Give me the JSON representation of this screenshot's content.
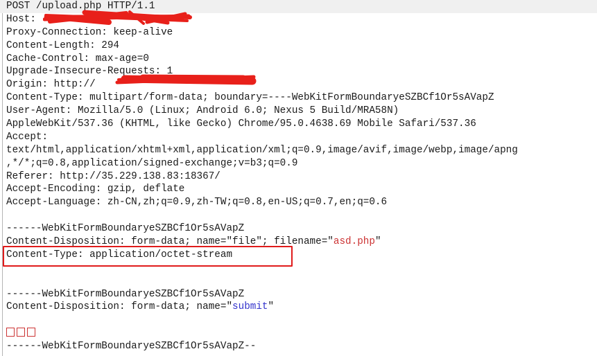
{
  "viewer": {
    "name": "http-request-raw-view",
    "boundary": "----WebKitFormBoundaryeSZBCf1Or5sAVapZ",
    "highlight_color": "#f0f0f0",
    "redaction_color": "#e8201a",
    "annotation_box_color": "#e01b1b",
    "string_red_color": "#cc3333",
    "string_blue_color": "#3333cc",
    "gutter_marker_color": "#e8a33d"
  },
  "lines": [
    {
      "id": "request-line",
      "text": "POST /upload.php HTTP/1.1",
      "highlight": true
    },
    {
      "id": "header-host",
      "text": "Host: "
    },
    {
      "id": "header-proxy-connection",
      "text": "Proxy-Connection: keep-alive"
    },
    {
      "id": "header-content-length",
      "text": "Content-Length: 294"
    },
    {
      "id": "header-cache-control",
      "text": "Cache-Control: max-age=0"
    },
    {
      "id": "header-upgrade-insecure",
      "text": "Upgrade-Insecure-Requests: 1"
    },
    {
      "id": "header-origin",
      "text": "Origin: http://"
    },
    {
      "id": "header-content-type",
      "text": "Content-Type: multipart/form-data; boundary=----WebKitFormBoundaryeSZBCf1Or5sAVapZ"
    },
    {
      "id": "header-user-agent",
      "text": "User-Agent: Mozilla/5.0 (Linux; Android 6.0; Nexus 5 Build/MRA58N)"
    },
    {
      "id": "header-user-agent-cont",
      "text": "AppleWebKit/537.36 (KHTML, like Gecko) Chrome/95.0.4638.69 Mobile Safari/537.36"
    },
    {
      "id": "header-accept",
      "text": "Accept:"
    },
    {
      "id": "header-accept-cont-1",
      "text": "text/html,application/xhtml+xml,application/xml;q=0.9,image/avif,image/webp,image/apng"
    },
    {
      "id": "header-accept-cont-2",
      "text": ",*/*;q=0.8,application/signed-exchange;v=b3;q=0.9"
    },
    {
      "id": "header-referer",
      "text": "Referer: http://35.229.138.83:18367/"
    },
    {
      "id": "header-accept-encoding",
      "text": "Accept-Encoding: gzip, deflate"
    },
    {
      "id": "header-accept-language",
      "text": "Accept-Language: zh-CN,zh;q=0.9,zh-TW;q=0.8,en-US;q=0.7,en;q=0.6"
    },
    {
      "id": "blank-1",
      "text": ""
    },
    {
      "id": "body-boundary-1",
      "text": "------WebKitFormBoundaryeSZBCf1Or5sAVapZ"
    },
    {
      "id": "body-part1-disposition",
      "text": "Content-Disposition: form-data; name=\"file\"; filename=\"asd.php\""
    },
    {
      "id": "body-part1-content-type",
      "text": "Content-Type: application/octet-stream"
    },
    {
      "id": "blank-2",
      "text": ""
    },
    {
      "id": "blank-3",
      "text": ""
    },
    {
      "id": "body-boundary-2",
      "text": "------WebKitFormBoundaryeSZBCf1Or5sAVapZ"
    },
    {
      "id": "body-part2-disposition",
      "text": "Content-Disposition: form-data; name=\"submit\""
    },
    {
      "id": "blank-4",
      "text": ""
    },
    {
      "id": "body-part2-value",
      "text": "□□□"
    },
    {
      "id": "body-boundary-final",
      "text": "------WebKitFormBoundaryeSZBCf1Or5sAVapZ--"
    }
  ],
  "segments": {
    "request_line": {
      "method": "POST",
      "path": "/upload.php",
      "version": "HTTP/1.1",
      "full": "POST /upload.php HTTP/1.1"
    },
    "host": {
      "label": "Host: ",
      "value_redacted": true
    },
    "proxy_connection": {
      "full": "Proxy-Connection: keep-alive"
    },
    "content_length": {
      "full": "Content-Length: 294"
    },
    "cache_control": {
      "full": "Cache-Control: max-age=0"
    },
    "upgrade_insecure": {
      "full": "Upgrade-Insecure-Requests: 1"
    },
    "origin": {
      "label": "Origin: http://",
      "value_redacted": true
    },
    "content_type": {
      "full": "Content-Type: multipart/form-data; boundary=----WebKitFormBoundaryeSZBCf1Or5sAVapZ"
    },
    "user_agent_1": {
      "full": "User-Agent: Mozilla/5.0 (Linux; Android 6.0; Nexus 5 Build/MRA58N)"
    },
    "user_agent_2": {
      "full": "AppleWebKit/537.36 (KHTML, like Gecko) Chrome/95.0.4638.69 Mobile Safari/537.36"
    },
    "accept_label": {
      "full": "Accept:"
    },
    "accept_1": {
      "full": "text/html,application/xhtml+xml,application/xml;q=0.9,image/avif,image/webp,image/apng"
    },
    "accept_2": {
      "full": ",*/*;q=0.8,application/signed-exchange;v=b3;q=0.9"
    },
    "referer": {
      "full": "Referer: http://35.229.138.83:18367/"
    },
    "accept_encoding": {
      "full": "Accept-Encoding: gzip, deflate"
    },
    "accept_language": {
      "full": "Accept-Language: zh-CN,zh;q=0.9,zh-TW;q=0.8,en-US;q=0.7,en;q=0.6"
    },
    "boundary_line": {
      "full": "------WebKitFormBoundaryeSZBCf1Or5sAVapZ"
    },
    "boundary_final": {
      "full": "------WebKitFormBoundaryeSZBCf1Or5sAVapZ--"
    },
    "disposition_file": {
      "prefix": "Content-Disposition: form-data; name=\"file\"; filename=\"",
      "filename": "asd.php",
      "suffix": "\""
    },
    "part_content_type": {
      "full": "Content-Type: application/octet-stream"
    },
    "disposition_submit": {
      "prefix": "Content-Disposition: form-data; name=\"",
      "field": "submit",
      "suffix": "\""
    },
    "submit_value": {
      "glyph_count": 3,
      "note": "unrenderable characters"
    }
  },
  "annotations": [
    {
      "id": "redact-host",
      "type": "scribble",
      "target": "header-host",
      "description": "red scribble over host value"
    },
    {
      "id": "redact-origin",
      "type": "bar",
      "target": "header-origin",
      "description": "red bar over origin value"
    },
    {
      "id": "box-content-type",
      "type": "rectangle",
      "target": "body-part1-content-type",
      "description": "red rectangle around Content-Type: application/octet-stream"
    }
  ]
}
